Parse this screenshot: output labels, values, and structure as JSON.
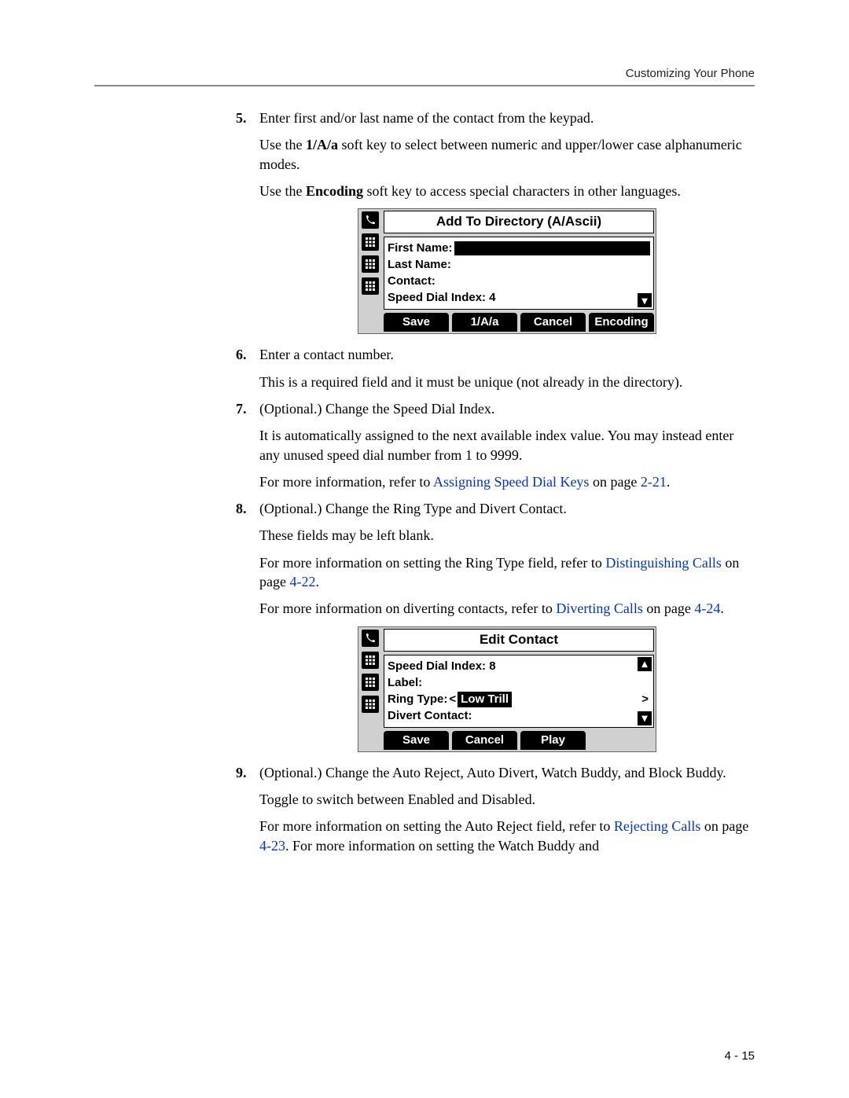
{
  "running_head": "Customizing Your Phone",
  "page_number": "4 - 15",
  "steps": {
    "s5": {
      "num": "5.",
      "p1": "Enter first and/or last name of the contact from the keypad.",
      "p2a": "Use the ",
      "p2b": "1/A/a",
      "p2c": " soft key to select between numeric and upper/lower case alphanumeric modes.",
      "p3a": "Use the ",
      "p3b": "Encoding",
      "p3c": " soft key to access special characters in other languages."
    },
    "s6": {
      "num": "6.",
      "p1": "Enter a contact number.",
      "p2": "This is a required field and it must be unique (not already in the directory)."
    },
    "s7": {
      "num": "7.",
      "p1": "(Optional.) Change the Speed Dial Index.",
      "p2": "It is automatically assigned to the next available index value. You may instead enter any unused speed dial number from 1 to 9999.",
      "p3a": "For more information, refer to ",
      "p3_link": "Assigning Speed Dial Keys",
      "p3b": " on page ",
      "p3_page": "2-21",
      "p3c": "."
    },
    "s8": {
      "num": "8.",
      "p1": "(Optional.) Change the Ring Type and Divert Contact.",
      "p2": "These fields may be left blank.",
      "p3a": "For more information on setting the Ring Type field, refer to ",
      "p3_link": "Distinguishing Calls",
      "p3b": " on page ",
      "p3_page": "4-22",
      "p3c": ".",
      "p4a": "For more information on diverting contacts, refer to ",
      "p4_link": "Diverting Calls",
      "p4b": " on page ",
      "p4_page": "4-24",
      "p4c": "."
    },
    "s9": {
      "num": "9.",
      "p1": "(Optional.) Change the Auto Reject, Auto Divert, Watch Buddy, and Block Buddy.",
      "p2": "Toggle to switch between Enabled and Disabled.",
      "p3a": "For more information on setting the Auto Reject field, refer to ",
      "p3_link": "Rejecting Calls",
      "p3b": " on page ",
      "p3_page": "4-23",
      "p3c": ". For more information on setting the Watch Buddy and"
    }
  },
  "fig1": {
    "title": "Add To Directory (A/Ascii)",
    "first_name": "First Name:",
    "last_name": "Last Name:",
    "contact": "Contact:",
    "speed_dial": "Speed Dial Index: 4",
    "softkeys": [
      "Save",
      "1/A/a",
      "Cancel",
      "Encoding"
    ]
  },
  "fig2": {
    "title": "Edit Contact",
    "speed_dial": "Speed Dial Index: 8",
    "label": "Label:",
    "ring_type_label": "Ring Type: ",
    "ring_prev": "<",
    "ring_selected": "Low Trill",
    "ring_next": ">",
    "divert": "Divert Contact:",
    "softkeys": [
      "Save",
      "Cancel",
      "Play"
    ]
  }
}
